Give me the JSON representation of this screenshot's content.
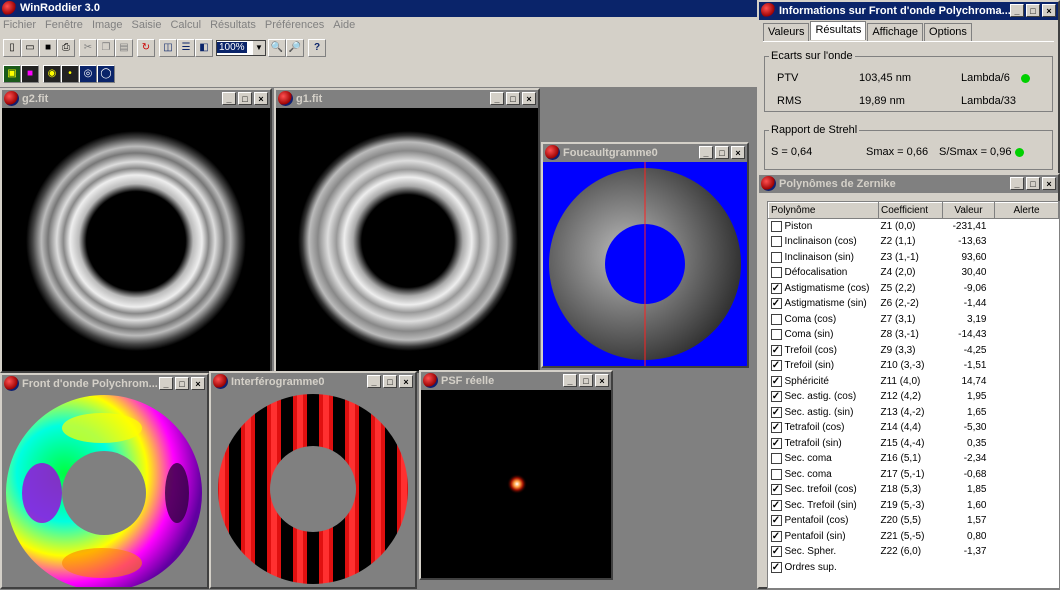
{
  "app": {
    "title": "WinRoddier 3.0"
  },
  "menu": [
    "Fichier",
    "Fenêtre",
    "Image",
    "Saisie",
    "Calcul",
    "Résultats",
    "Préférences",
    "Aide"
  ],
  "toolbar": {
    "zoom": "100%"
  },
  "windows": {
    "g2": {
      "title": "g2.fit"
    },
    "g1": {
      "title": "g1.fit"
    },
    "foucault": {
      "title": "Foucaultgramme0"
    },
    "front": {
      "title": "Front d'onde Polychrom..."
    },
    "interfero": {
      "title": "Interférogramme0"
    },
    "psf": {
      "title": "PSF réelle"
    }
  },
  "info": {
    "title": "Informations sur Front d'onde Polychroma...",
    "tabs": [
      "Valeurs",
      "Résultats",
      "Affichage",
      "Options"
    ],
    "selected_tab": "Résultats",
    "ecarts": {
      "legend": "Ecarts sur l'onde",
      "ptv_label": "PTV",
      "ptv_value": "103,45 nm",
      "ptv_lambda": "Lambda/6",
      "rms_label": "RMS",
      "rms_value": "19,89 nm",
      "rms_lambda": "Lambda/33"
    },
    "strehl": {
      "legend": "Rapport de Strehl",
      "s": "S = 0,64",
      "smax": "Smax = 0,66",
      "ratio": "S/Smax = 0,96"
    },
    "status_color": "#00d000"
  },
  "zernike": {
    "title": "Polynômes de Zernike",
    "headers": {
      "poly": "Polynôme",
      "coef": "Coefficient",
      "val": "Valeur",
      "alert": "Alerte"
    },
    "rows": [
      {
        "name": "Piston",
        "coef": "Z1 (0,0)",
        "val": "-231,41",
        "checked": false
      },
      {
        "name": "Inclinaison (cos)",
        "coef": "Z2 (1,1)",
        "val": "-13,63",
        "checked": false
      },
      {
        "name": "Inclinaison (sin)",
        "coef": "Z3 (1,-1)",
        "val": "93,60",
        "checked": false
      },
      {
        "name": "Défocalisation",
        "coef": "Z4 (2,0)",
        "val": "30,40",
        "checked": false
      },
      {
        "name": "Astigmatisme (cos)",
        "coef": "Z5 (2,2)",
        "val": "-9,06",
        "checked": true
      },
      {
        "name": "Astigmatisme (sin)",
        "coef": "Z6 (2,-2)",
        "val": "-1,44",
        "checked": true
      },
      {
        "name": "Coma (cos)",
        "coef": "Z7 (3,1)",
        "val": "3,19",
        "checked": false
      },
      {
        "name": "Coma (sin)",
        "coef": "Z8 (3,-1)",
        "val": "-14,43",
        "checked": false
      },
      {
        "name": "Trefoil (cos)",
        "coef": "Z9 (3,3)",
        "val": "-4,25",
        "checked": true
      },
      {
        "name": "Trefoil (sin)",
        "coef": "Z10 (3,-3)",
        "val": "-1,51",
        "checked": true
      },
      {
        "name": "Sphéricité",
        "coef": "Z11 (4,0)",
        "val": "14,74",
        "checked": true
      },
      {
        "name": "Sec. astig. (cos)",
        "coef": "Z12 (4,2)",
        "val": "1,95",
        "checked": true
      },
      {
        "name": "Sec. astig. (sin)",
        "coef": "Z13 (4,-2)",
        "val": "1,65",
        "checked": true
      },
      {
        "name": "Tetrafoil (cos)",
        "coef": "Z14 (4,4)",
        "val": "-5,30",
        "checked": true
      },
      {
        "name": "Tetrafoil (sin)",
        "coef": "Z15 (4,-4)",
        "val": "0,35",
        "checked": true
      },
      {
        "name": "Sec. coma",
        "coef": "Z16 (5,1)",
        "val": "-2,34",
        "checked": false
      },
      {
        "name": "Sec. coma",
        "coef": "Z17 (5,-1)",
        "val": "-0,68",
        "checked": false
      },
      {
        "name": "Sec. trefoil (cos)",
        "coef": "Z18 (5,3)",
        "val": "1,85",
        "checked": true
      },
      {
        "name": "Sec. Trefoil (sin)",
        "coef": "Z19 (5,-3)",
        "val": "1,60",
        "checked": true
      },
      {
        "name": "Pentafoil (cos)",
        "coef": "Z20 (5,5)",
        "val": "1,57",
        "checked": true
      },
      {
        "name": "Pentafoil (sin)",
        "coef": "Z21 (5,-5)",
        "val": "0,80",
        "checked": true
      },
      {
        "name": "Sec. Spher.",
        "coef": "Z22 (6,0)",
        "val": "-1,37",
        "checked": true
      },
      {
        "name": "Ordres sup.",
        "coef": "",
        "val": "",
        "checked": true
      }
    ]
  },
  "colors": {
    "titlebar_active": "#0a246a",
    "titlebar_inactive": "#808080",
    "foucault_bg": "#0000ff"
  }
}
